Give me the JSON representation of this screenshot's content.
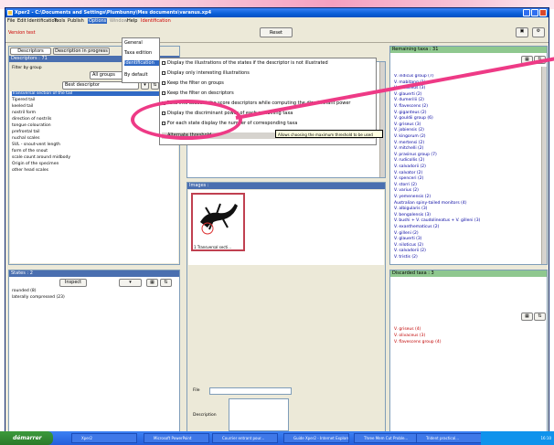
{
  "window": {
    "title": "Xper2 - C:\\Documents and Settings\\Plumbunny\\Mes documents\\varanus.xp4"
  },
  "menubar": [
    "File",
    "Edit",
    "Identification",
    "Tools",
    "Publish",
    "Options",
    "Window",
    "Help",
    "Identification"
  ],
  "toolbar": {
    "version": "Version test",
    "reset": "Reset"
  },
  "options_menu": [
    "General",
    "Taxa edition",
    "Identification",
    "By default"
  ],
  "identification_submenu": [
    "Display the illustrations of the states if the descriptor is not illustrated",
    "Display only interesting illustrations",
    "Keep the filter on groups",
    "Keep the filter on descriptors",
    "Take into account the score descriptors while computing the discriminant power",
    "Display the discriminant power of each remaining taxa",
    "For each state display the number of corresponding taxa",
    "Alternate threshold"
  ],
  "tooltip": "Allows choosing the maximum threshold to be used",
  "left_panel": {
    "tabs": [
      "Descriptors",
      "Description in progress"
    ],
    "header": "Descriptors : 71",
    "filter_label": "Filter by group",
    "filter_value": "All groups",
    "sort_label": "Best descriptor",
    "items": [
      "Transversal section of the tail",
      "Tipered tail",
      "keeled tail",
      "nostril form",
      "direction of nostrils",
      "tongue colouration",
      "prefrontal tail",
      "nuchal scales",
      "SVL - snout-vent length",
      "form of the snout",
      "scale count around midbody",
      "Origin of the specimen",
      "other head scales"
    ]
  },
  "states_panel": {
    "header": "States : 2",
    "button": "Inspect",
    "items": [
      "rounded (8)",
      "laterally compressed (23)"
    ]
  },
  "middle_panel": {
    "images_header": "Images :",
    "image_caption": "1 Transversal secti...",
    "file_label": "File",
    "description_label": "Description"
  },
  "remaining_panel": {
    "header": "Remaining taxa : 31",
    "items": [
      "V. indicus group (7)",
      "V. mabitang (1)",
      "V. olivaceus (3)",
      "V. glauerti (2)",
      "V. dumerilii (2)",
      "V. flavescens (2)",
      "V. giganteus (2)",
      "V. gouldii group (6)",
      "V. griseus (3)",
      "V. jobiensis (2)",
      "V. kingorum (2)",
      "V. mertensi (2)",
      "V. mitchelli (2)",
      "V. prasinus group (7)",
      "V. rudicollis (2)",
      "V. salvadorii (2)",
      "V. salvator (2)",
      "V. spenceri (2)",
      "V. storri (2)",
      "V. varius (2)",
      "V. yemenensis (2)",
      "Australian spiny-tailed monitors (4)",
      "V. albigularis (3)",
      "V. bengalensis (3)",
      "V. bushi + V. caudolineatus + V. gilleni (3)",
      "V. exanthematicus (2)",
      "V. gilleni (2)",
      "V. glauerti (3)",
      "V. niloticus (2)",
      "V. salvadorii (2)",
      "V. tristis (2)"
    ]
  },
  "discarded_panel": {
    "header": "Discarded taxa : 3",
    "items": [
      "V. griseus (4)",
      "V. olivaceus (3)",
      "V. flavescens group (4)"
    ]
  },
  "taskbar": {
    "start": "démarrer",
    "tasks": [
      "Xper2",
      "Microsoft PowerPoint",
      "Courrier entrant pour...",
      "Guide Xper2 - Internet Explorer",
      "Three Mem Cut Proble...",
      "Trident practical..."
    ],
    "clock": "16:10"
  }
}
